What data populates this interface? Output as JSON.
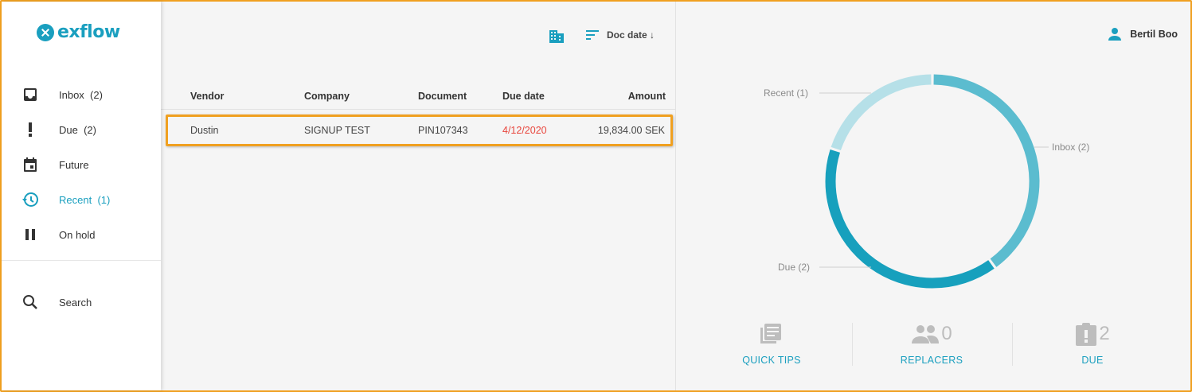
{
  "brand": {
    "name": "exflow"
  },
  "nav": {
    "items": [
      {
        "label": "Inbox",
        "count": "(2)",
        "icon": "inbox-icon"
      },
      {
        "label": "Due",
        "count": "(2)",
        "icon": "exclamation-icon"
      },
      {
        "label": "Future",
        "count": "",
        "icon": "calendar-icon"
      },
      {
        "label": "Recent",
        "count": "(1)",
        "icon": "history-icon",
        "active": true
      },
      {
        "label": "On hold",
        "count": "",
        "icon": "pause-icon"
      }
    ],
    "search_label": "Search"
  },
  "toolbar": {
    "sort_label": "Doc date ↓"
  },
  "table": {
    "columns": [
      "Vendor",
      "Company",
      "Document",
      "Due date",
      "Amount"
    ],
    "rows": [
      {
        "vendor": "Dustin",
        "company": "SIGNUP TEST",
        "document": "PIN107343",
        "due_date": "4/12/2020",
        "amount": "19,834.00 SEK"
      }
    ]
  },
  "user": {
    "name": "Bertil Boo"
  },
  "chart_data": {
    "type": "pie",
    "donut": true,
    "categories": [
      "Inbox (2)",
      "Due (2)",
      "Recent (1)"
    ],
    "values": [
      2,
      2,
      1
    ],
    "colors": [
      "#5bbccf",
      "#17a0bd",
      "#b6e0e8"
    ]
  },
  "tiles": [
    {
      "label": "QUICK TIPS",
      "count": "",
      "icon": "tips-icon"
    },
    {
      "label": "REPLACERS",
      "count": "0",
      "icon": "people-icon"
    },
    {
      "label": "DUE",
      "count": "2",
      "icon": "clipboard-alert-icon"
    }
  ],
  "colors": {
    "accent": "#1a9fbf",
    "overdue": "#e8453c",
    "highlight": "#f0a020"
  }
}
